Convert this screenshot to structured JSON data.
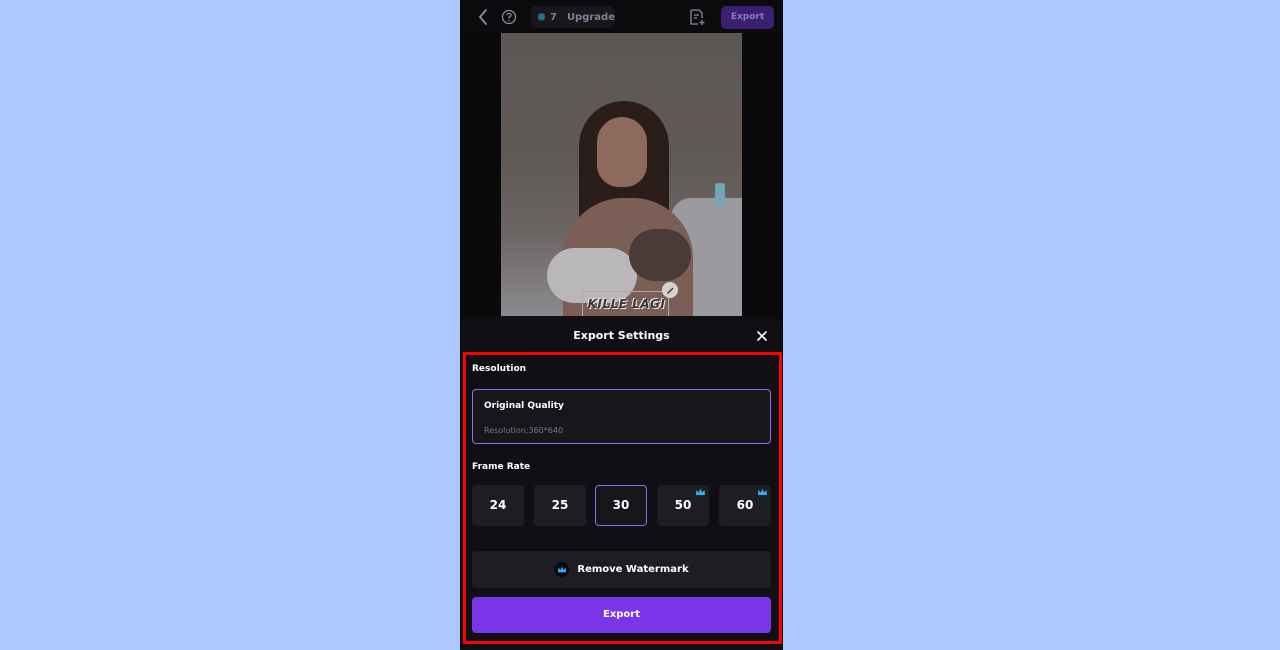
{
  "topbar": {
    "credits": "7",
    "upgrade_label": "Upgrade",
    "export_label": "Export"
  },
  "preview": {
    "caption": "KILLE LAGI"
  },
  "sheet": {
    "title": "Export Settings",
    "resolution_label": "Resolution",
    "resolution_option_title": "Original Quality",
    "resolution_option_detail": "Resolution:360*640",
    "frame_rate_label": "Frame Rate",
    "frame_rates": [
      {
        "value": "24",
        "selected": false,
        "premium": false
      },
      {
        "value": "25",
        "selected": false,
        "premium": false
      },
      {
        "value": "30",
        "selected": true,
        "premium": false
      },
      {
        "value": "50",
        "selected": false,
        "premium": true
      },
      {
        "value": "60",
        "selected": false,
        "premium": true
      }
    ],
    "remove_watermark_label": "Remove Watermark",
    "export_button_label": "Export"
  },
  "colors": {
    "accent": "#7a35e8",
    "selected_border": "#8a6ff0",
    "crown": "#29b6f6",
    "highlight": "#ff0000"
  },
  "icons": [
    "back-arrow-icon",
    "help-icon",
    "coin-stack-icon",
    "document-add-icon",
    "close-icon",
    "crown-icon",
    "pencil-icon"
  ]
}
